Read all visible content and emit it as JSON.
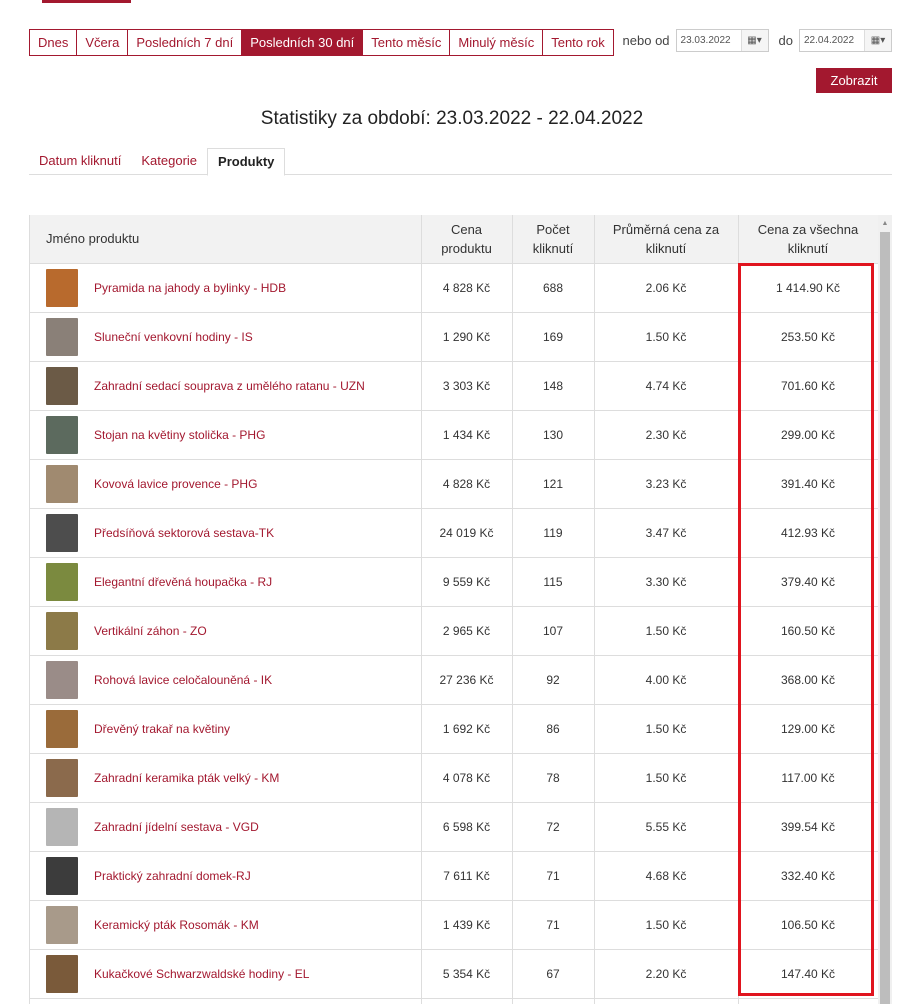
{
  "period_buttons": [
    "Dnes",
    "Včera",
    "Posledních 7 dní",
    "Posledních 30 dní",
    "Tento měsíc",
    "Minulý měsíc",
    "Tento rok"
  ],
  "active_period": "Posledních 30 dní",
  "range": {
    "from_label": "nebo od",
    "from_value": "23.03.2022",
    "to_label": "do",
    "to_value": "22.04.2022",
    "calendar_icon": "calendar-icon"
  },
  "submit_label": "Zobrazit",
  "page_title": "Statistiky za období: 23.03.2022 - 22.04.2022",
  "tabs": [
    "Datum kliknutí",
    "Kategorie",
    "Produkty"
  ],
  "active_tab": "Produkty",
  "table": {
    "headers": [
      "Jméno produktu",
      "Cena produktu",
      "Počet kliknutí",
      "Průměrná cena za kliknutí",
      "Cena za všechna kliknutí"
    ],
    "rows": [
      {
        "name": "Pyramida na jahody a bylinky - HDB",
        "price": "4 828 Kč",
        "clicks": "688",
        "avg": "2.06 Kč",
        "total": "1 414.90 Kč"
      },
      {
        "name": "Sluneční venkovní hodiny - IS",
        "price": "1 290 Kč",
        "clicks": "169",
        "avg": "1.50 Kč",
        "total": "253.50 Kč"
      },
      {
        "name": "Zahradní sedací souprava z umělého ratanu - UZN",
        "price": "3 303 Kč",
        "clicks": "148",
        "avg": "4.74 Kč",
        "total": "701.60 Kč"
      },
      {
        "name": "Stojan na květiny stolička - PHG",
        "price": "1 434 Kč",
        "clicks": "130",
        "avg": "2.30 Kč",
        "total": "299.00 Kč"
      },
      {
        "name": "Kovová lavice provence - PHG",
        "price": "4 828 Kč",
        "clicks": "121",
        "avg": "3.23 Kč",
        "total": "391.40 Kč"
      },
      {
        "name": "Předsíňová sektorová sestava-TK",
        "price": "24 019 Kč",
        "clicks": "119",
        "avg": "3.47 Kč",
        "total": "412.93 Kč"
      },
      {
        "name": "Elegantní dřevěná houpačka - RJ",
        "price": "9 559 Kč",
        "clicks": "115",
        "avg": "3.30 Kč",
        "total": "379.40 Kč"
      },
      {
        "name": "Vertikální záhon - ZO",
        "price": "2 965 Kč",
        "clicks": "107",
        "avg": "1.50 Kč",
        "total": "160.50 Kč"
      },
      {
        "name": "Rohová lavice celočalouněná - IK",
        "price": "27 236 Kč",
        "clicks": "92",
        "avg": "4.00 Kč",
        "total": "368.00 Kč"
      },
      {
        "name": "Dřevěný trakař na květiny",
        "price": "1 692 Kč",
        "clicks": "86",
        "avg": "1.50 Kč",
        "total": "129.00 Kč"
      },
      {
        "name": "Zahradní keramika pták velký - KM",
        "price": "4 078 Kč",
        "clicks": "78",
        "avg": "1.50 Kč",
        "total": "117.00 Kč"
      },
      {
        "name": "Zahradní jídelní sestava - VGD",
        "price": "6 598 Kč",
        "clicks": "72",
        "avg": "5.55 Kč",
        "total": "399.54 Kč"
      },
      {
        "name": "Praktický zahradní domek-RJ",
        "price": "7 611 Kč",
        "clicks": "71",
        "avg": "4.68 Kč",
        "total": "332.40 Kč"
      },
      {
        "name": "Keramický pták Rosomák - KM",
        "price": "1 439 Kč",
        "clicks": "71",
        "avg": "1.50 Kč",
        "total": "106.50 Kč"
      },
      {
        "name": "Kukačkové Schwarzwaldské hodiny - EL",
        "price": "5 354 Kč",
        "clicks": "67",
        "avg": "2.20 Kč",
        "total": "147.40 Kč"
      },
      {
        "name": "",
        "price": "",
        "clicks": "",
        "avg": "",
        "total": ""
      }
    ]
  },
  "colors": {
    "accent": "#a3182f",
    "highlight": "#e0141e",
    "thumbs": [
      "#b86a2d",
      "#8a8078",
      "#6b5a46",
      "#5c6a5e",
      "#a08a70",
      "#4d4d4d",
      "#7b8a3f",
      "#8c7a48",
      "#9a8c88",
      "#9a6b3a",
      "#8b6a4c",
      "#b5b5b5",
      "#3c3c3c",
      "#a89a8a",
      "#7a5a3a",
      "#ffffff"
    ]
  }
}
